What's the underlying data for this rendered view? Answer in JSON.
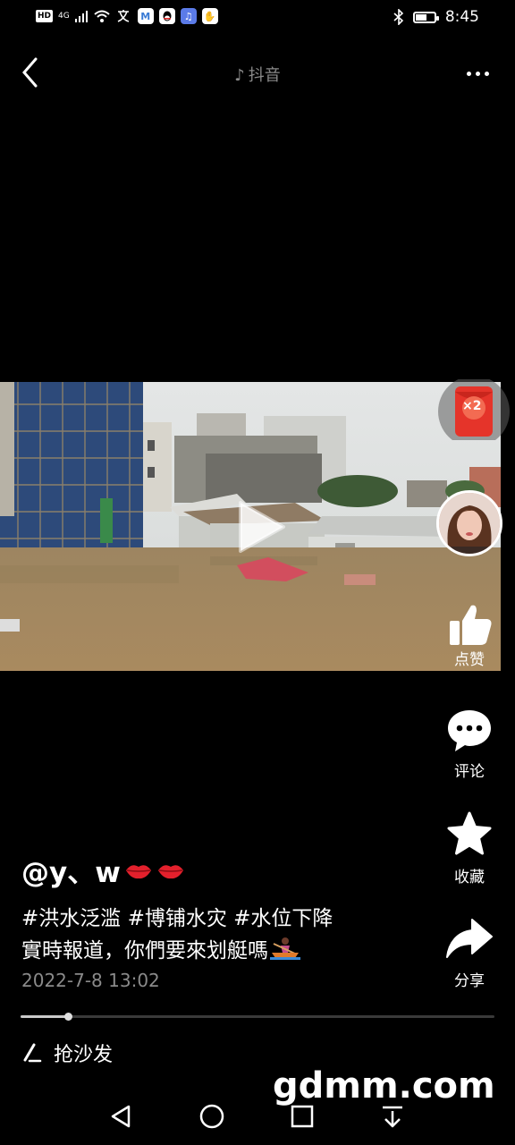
{
  "status_bar": {
    "hd": "HD",
    "network": "4G",
    "time": "8:45"
  },
  "top_bar": {
    "title": "抖音"
  },
  "right_rail": {
    "red_packet": "×2",
    "like_label": "点赞",
    "comment_label": "评论",
    "favorite_label": "收藏",
    "share_label": "分享"
  },
  "post": {
    "author": "@y、w",
    "hashtags": "#洪水泛滥 #博铺水灾 #水位下降",
    "text": "實時報道，你們要來划艇嗎",
    "date": "2022-7-8 13:02",
    "progress": 0.1
  },
  "comment_bar": {
    "placeholder": "抢沙发"
  },
  "watermark": "gdmm.com",
  "colors": {
    "background": "#000000",
    "muted_text": "#8a8a8a",
    "red_packet": "#e5342a",
    "flood_water": "#a98a5f"
  }
}
